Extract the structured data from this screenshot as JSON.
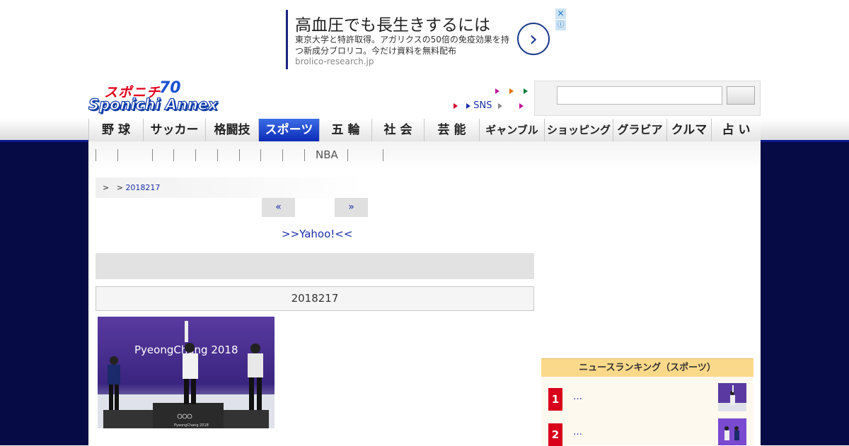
{
  "ad": {
    "headline": "高血圧でも長生きするには",
    "body": "東京大学と特許取得。アガリクスの50倍の免疫効果を持つ新成分ブロリコ。今だけ資料を無料配布",
    "url": "brolico-research.jp",
    "arrow": "›",
    "close": "✕",
    "info": "ⓘ"
  },
  "logo": {
    "top": "スポニチ",
    "anniv": "70",
    "main": "Sponichi Annex"
  },
  "header": {
    "sns_label": "SNS"
  },
  "nav": {
    "items": [
      "野 球",
      "サッカー",
      "格闘技",
      "スポーツ",
      "五 輪",
      "社 会",
      "芸 能",
      "ギャンブル",
      "ショッピング",
      "グラビア",
      "クルマ",
      "占 い"
    ],
    "active": "スポーツ"
  },
  "subnav": {
    "nba": "NBA"
  },
  "breadcrumb": {
    "sep1": ">",
    "sep2": ">",
    "link": "2018217"
  },
  "pager": {
    "prev": "«",
    "next": "»"
  },
  "yahoo_link": ">>Yahoo!<<",
  "article": {
    "date": "2018217"
  },
  "photo": {
    "banner_text": "PyeongChang 2018",
    "podium_text": "PyeongChang 2018"
  },
  "ranking": {
    "title": "ニュースランキング（スポーツ）",
    "items": [
      {
        "rank": "1",
        "title": "…"
      },
      {
        "rank": "2",
        "title": "…"
      }
    ]
  },
  "colors": {
    "navy": "#060a45",
    "active_nav": "#0b2bb5",
    "rank_red": "#d9001b",
    "rank_header": "#fbd98a"
  }
}
